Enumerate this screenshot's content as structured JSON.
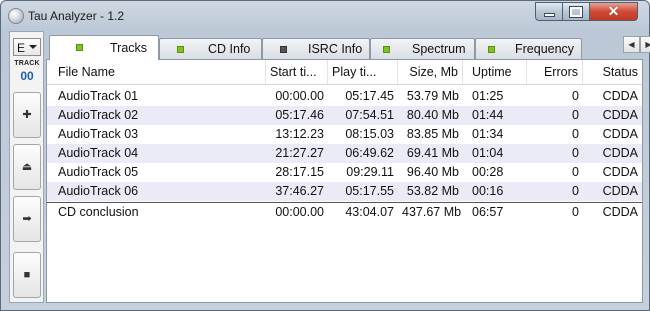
{
  "window": {
    "title": "Tau Analyzer - 1.2"
  },
  "left_panel": {
    "combo_value": "E",
    "track_label": "TRACK",
    "track_number": "00",
    "buttons": [
      {
        "name": "add",
        "glyph": "✚"
      },
      {
        "name": "eject",
        "glyph": "⏏"
      },
      {
        "name": "next",
        "glyph": "➡"
      },
      {
        "name": "stop",
        "glyph": "■"
      }
    ]
  },
  "tabs": [
    {
      "label": "Tracks",
      "led": "green",
      "active": true
    },
    {
      "label": "CD Info",
      "led": "green"
    },
    {
      "label": "ISRC Info",
      "led": "dark"
    },
    {
      "label": "Spectrum",
      "led": "green"
    },
    {
      "label": "Frequency",
      "led": "green"
    }
  ],
  "columns": [
    "File Name",
    "Start ti...",
    "Play ti...",
    "Size, Mb",
    "Uptime",
    "Errors",
    "Status"
  ],
  "rows": [
    [
      "AudioTrack 01",
      "00:00.00",
      "05:17.45",
      "53.79 Mb",
      "01:25",
      "0",
      "CDDA"
    ],
    [
      "AudioTrack 02",
      "05:17.46",
      "07:54.51",
      "80.40 Mb",
      "01:44",
      "0",
      "CDDA"
    ],
    [
      "AudioTrack 03",
      "13:12.23",
      "08:15.03",
      "83.85 Mb",
      "01:34",
      "0",
      "CDDA"
    ],
    [
      "AudioTrack 04",
      "21:27.27",
      "06:49.62",
      "69.41 Mb",
      "01:04",
      "0",
      "CDDA"
    ],
    [
      "AudioTrack 05",
      "28:17.15",
      "09:29.11",
      "96.40 Mb",
      "00:28",
      "0",
      "CDDA"
    ],
    [
      "AudioTrack 06",
      "37:46.27",
      "05:17.55",
      "53.82 Mb",
      "00:16",
      "0",
      "CDDA"
    ]
  ],
  "summary": [
    "CD conclusion",
    "00:00.00",
    "43:04.07",
    "437.67 Mb",
    "06:57",
    "0",
    "CDDA"
  ]
}
